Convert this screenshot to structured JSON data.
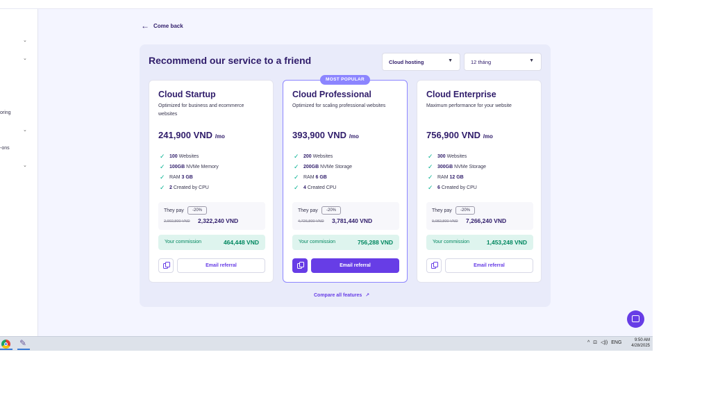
{
  "sidebar": {
    "items": [
      {
        "label": "",
        "chevron": "⌄"
      },
      {
        "label": "",
        "chevron": "⌄"
      },
      {
        "label": "oring",
        "chevron": ""
      },
      {
        "label": "",
        "chevron": "⌄"
      },
      {
        "label": "-ons",
        "chevron": ""
      },
      {
        "label": "",
        "chevron": "⌄"
      }
    ]
  },
  "header": {
    "back_label": "Come back",
    "back_icon": "arrow-left-icon"
  },
  "panel": {
    "title": "Recommend our service to a friend",
    "product_select": "Cloud hosting",
    "period_select": "12 tháng",
    "popular_badge": "MOST POPULAR",
    "compare_link": "Compare all features"
  },
  "plans": [
    {
      "name": "Cloud Startup",
      "description": "Optimized for business and ecommerce websites",
      "price": "241,900 VND",
      "price_unit": "/mo",
      "features": [
        {
          "bold": "100",
          "text": " Websites"
        },
        {
          "bold": "100GB",
          "text": " NVMe Memory"
        },
        {
          "prefix": "RAM ",
          "bold": "3 GB",
          "text": ""
        },
        {
          "bold": "2",
          "text": " Created by CPU"
        }
      ],
      "they_pay_label": "They pay",
      "discount": "-20%",
      "old_price": "2,902,800 VND",
      "new_price": "2,322,240 VND",
      "commission_label": "Your commission",
      "commission": "464,448 VND",
      "email_label": "Email referral"
    },
    {
      "name": "Cloud Professional",
      "description": "Optimized for scaling professional websites",
      "price": "393,900 VND",
      "price_unit": "/mo",
      "features": [
        {
          "bold": "200",
          "text": " Websites"
        },
        {
          "bold": "200GB",
          "text": " NVMe Storage"
        },
        {
          "prefix": "RAM ",
          "bold": "6 GB",
          "text": ""
        },
        {
          "bold": "4",
          "text": " Created CPU"
        }
      ],
      "they_pay_label": "They pay",
      "discount": "-20%",
      "old_price": "4,726,800 VND",
      "new_price": "3,781,440 VND",
      "commission_label": "Your commission",
      "commission": "756,288 VND",
      "email_label": "Email referral"
    },
    {
      "name": "Cloud Enterprise",
      "description": "Maximum performance for your website",
      "price": "756,900 VND",
      "price_unit": "/mo",
      "features": [
        {
          "bold": "300",
          "text": " Websites"
        },
        {
          "bold": "300GB",
          "text": " NVMe Storage"
        },
        {
          "prefix": "RAM ",
          "bold": "12 GB",
          "text": ""
        },
        {
          "bold": "6",
          "text": " Created by CPU"
        }
      ],
      "they_pay_label": "They pay",
      "discount": "-20%",
      "old_price": "9,082,800 VND",
      "new_price": "7,266,240 VND",
      "commission_label": "Your commission",
      "commission": "1,453,248 VND",
      "email_label": "Email referral"
    }
  ],
  "taskbar": {
    "tray_chevron": "^",
    "tray_network": "⊡",
    "tray_volume": "◁))",
    "language": "ENG",
    "time": "9:50 AM",
    "date": "4/28/2025"
  },
  "colors": {
    "accent": "#673de6",
    "popular": "#8c85ff",
    "commission_bg": "#def4ee",
    "commission_text": "#00875f",
    "check": "#00b090"
  }
}
